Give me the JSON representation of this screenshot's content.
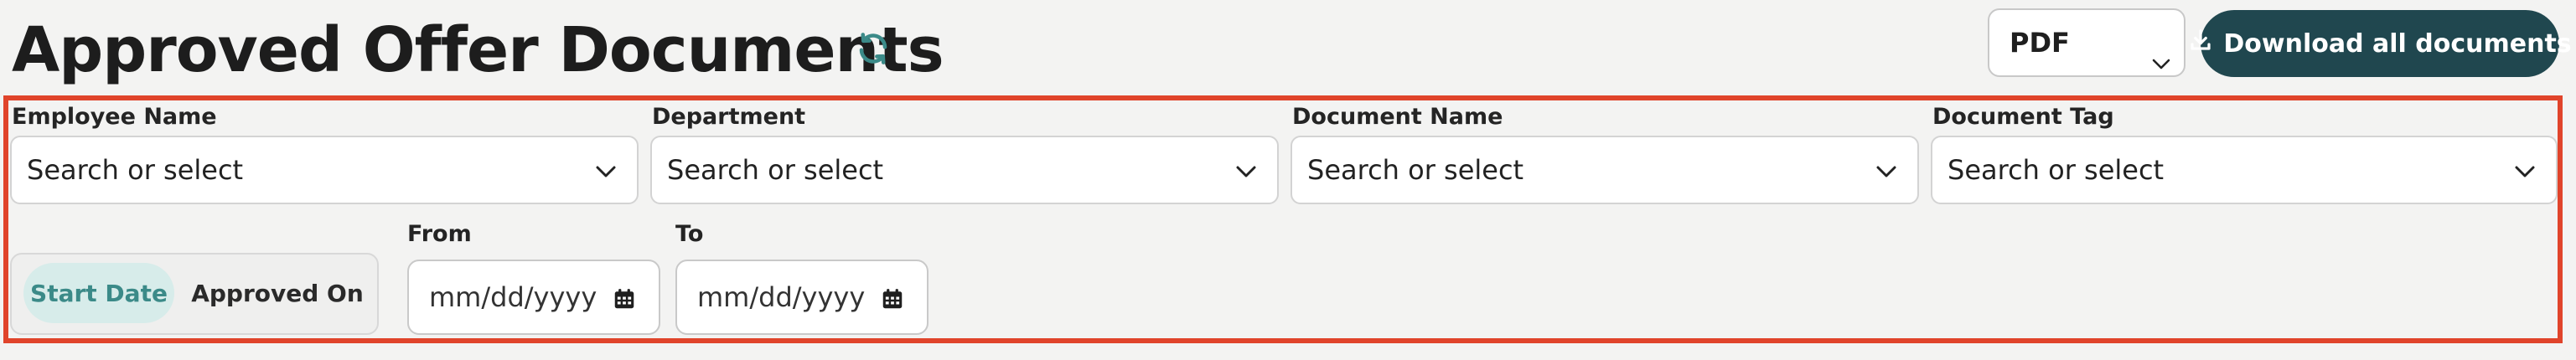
{
  "header": {
    "title": "Approved Offer Documents",
    "format_value": "PDF",
    "download_label": "Download all documents"
  },
  "filters": {
    "employee": {
      "label": "Employee Name",
      "placeholder": "Search or select"
    },
    "department": {
      "label": "Department",
      "placeholder": "Search or select"
    },
    "document_name": {
      "label": "Document Name",
      "placeholder": "Search or select"
    },
    "document_tag": {
      "label": "Document Tag",
      "placeholder": "Search or select"
    },
    "date_type": {
      "options": [
        "Start Date",
        "Approved On"
      ],
      "selected": "Start Date"
    },
    "from": {
      "label": "From",
      "placeholder": "mm/dd/yyyy"
    },
    "to": {
      "label": "To",
      "placeholder": "mm/dd/yyyy"
    }
  },
  "colors": {
    "accent": "#20474f",
    "highlight_border": "#e0442b",
    "toggle_active_bg": "#d7ecea",
    "toggle_active_text": "#3b8a88",
    "refresh_icon": "#3b8a88"
  },
  "icons": [
    "refresh-icon",
    "chevron-down-icon",
    "download-icon",
    "calendar-icon"
  ]
}
